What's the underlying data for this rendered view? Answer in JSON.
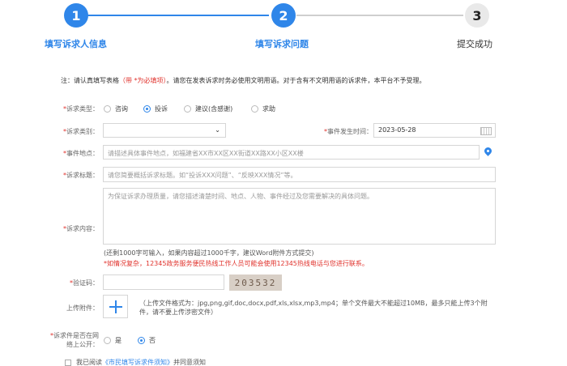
{
  "steps": [
    {
      "number": "1",
      "label": "填写诉求人信息"
    },
    {
      "number": "2",
      "label": "填写诉求问题"
    },
    {
      "number": "3",
      "label": "提交成功"
    }
  ],
  "notice": {
    "prefix": "注：请认真填写表格",
    "required": "（带 *为必填项）",
    "suffix": "。请您在发表诉求时务必使用文明用语。对于含有不文明用语的诉求件，本平台不予受理。"
  },
  "form": {
    "type": {
      "label": "诉求类型：",
      "options": [
        "咨询",
        "投诉",
        "建议(含感谢)",
        "求助"
      ],
      "selected": "投诉"
    },
    "category": {
      "label": "诉求类别：",
      "value": ""
    },
    "event_time": {
      "label": "事件发生时间：",
      "value": "2023-05-28"
    },
    "location": {
      "label": "事件地点：",
      "placeholder": "请描述具体事件地点，如福建省XX市XX区XX街道XX路XX小区XX楼"
    },
    "title": {
      "label": "诉求标题：",
      "placeholder": "请您简要概括诉求标题。如“投诉XXX问题”、“反映XXX情况”等。"
    },
    "content": {
      "label": "诉求内容：",
      "placeholder": "为保证诉求办理质量，请您描述清楚时间、地点、人物、事件经过及您需要解决的具体问题。",
      "hint": "(还剩1000字可输入，如果内容超过1000千字，建议Word附件方式提交)",
      "warning": "*如情况复杂，12345政务服务便民热线工作人员可能会使用12345热线电话与您进行联系。"
    },
    "captcha": {
      "label": "验证码：",
      "value": "",
      "code": "203532"
    },
    "attachment": {
      "label": "上传附件：",
      "note": "（上传文件格式为：jpg,png,gif,doc,docx,pdf,xls,xlsx,mp3,mp4；单个文件最大不能超过10MB，最多只能上传3个附件，请不要上传涉密文件）"
    },
    "public": {
      "label_line1": "诉求件是否在网",
      "label_line2": "络上公开：",
      "options": [
        "是",
        "否"
      ],
      "selected": "否"
    },
    "agree": {
      "prefix": "我已阅读",
      "link": "《市民填写诉求件须知》",
      "suffix": "并同意须知"
    }
  },
  "icons": {
    "calendar": "calendar-icon",
    "location": "location-pin-icon",
    "add": "plus-icon",
    "select": "chevron-down-icon"
  },
  "colors": {
    "accent": "#2f86e9",
    "required": "#e0312b",
    "inactive": "#e9e9e9"
  }
}
